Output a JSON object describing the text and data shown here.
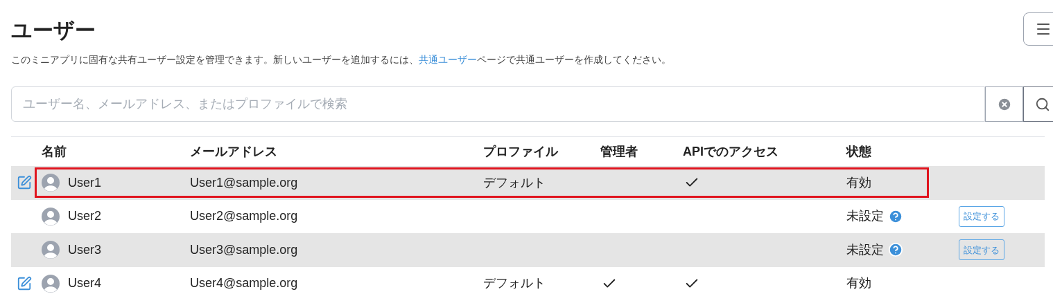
{
  "page": {
    "title": "ユーザー",
    "description_before": "このミニアプリに固有な共有ユーザー設定を管理できます。新しいユーザーを追加するには、",
    "description_link": "共通ユーザー",
    "description_after": "ページで共通ユーザーを作成してください。"
  },
  "search": {
    "placeholder": "ユーザー名、メールアドレス、またはプロファイルで検索"
  },
  "table": {
    "columns": [
      "名前",
      "メールアドレス",
      "プロファイル",
      "管理者",
      "APIでのアクセス",
      "状態"
    ],
    "rows": [
      {
        "editable": true,
        "name": "User1",
        "email": "User1@sample.org",
        "profile": "デフォルト",
        "admin": false,
        "api_access": true,
        "status": "有効",
        "status_help": false,
        "highlighted": true
      },
      {
        "editable": false,
        "name": "User2",
        "email": "User2@sample.org",
        "admin": false,
        "api_access": false,
        "status": "未設定",
        "status_help": true,
        "action": "設定する",
        "highlighted": false
      },
      {
        "editable": false,
        "name": "User3",
        "email": "User3@sample.org",
        "admin": false,
        "api_access": false,
        "status": "未設定",
        "status_help": true,
        "action": "設定する",
        "highlighted": false
      },
      {
        "editable": true,
        "name": "User4",
        "email": "User4@sample.org",
        "profile": "デフォルト",
        "admin": true,
        "api_access": true,
        "status": "有効",
        "status_help": false,
        "highlighted": false
      }
    ]
  }
}
